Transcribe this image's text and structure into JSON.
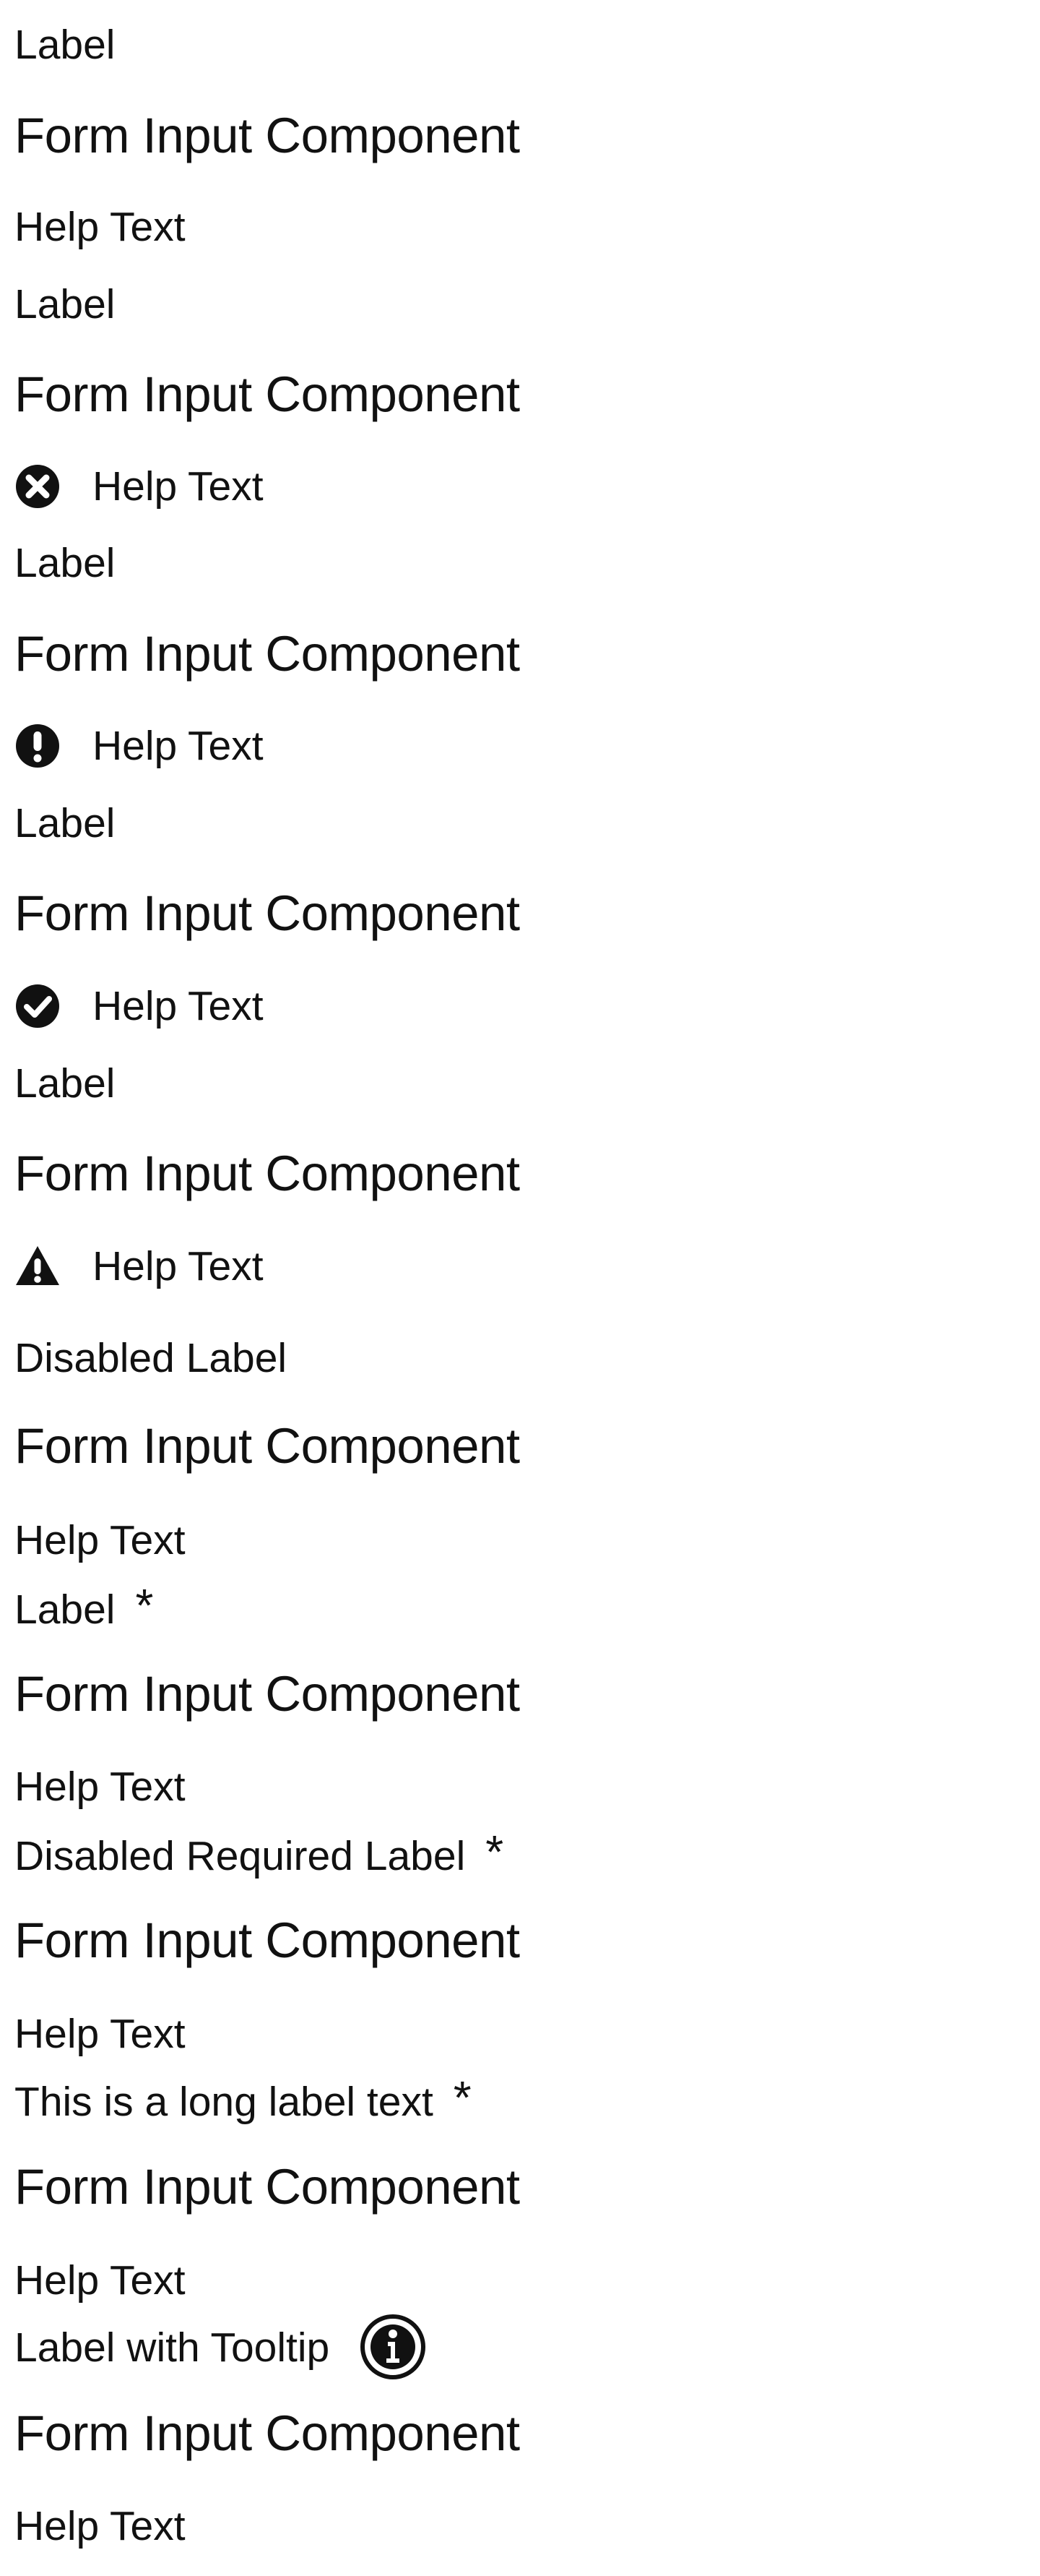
{
  "fields": [
    {
      "label": "Label",
      "input_text": "Form Input Component",
      "help_text": "Help Text"
    },
    {
      "label": "Label",
      "input_text": "Form Input Component",
      "help_text": "Help Text",
      "status_icon": "error-circle-icon"
    },
    {
      "label": "Label",
      "input_text": "Form Input Component",
      "help_text": "Help Text",
      "status_icon": "warning-circle-icon"
    },
    {
      "label": "Label",
      "input_text": "Form Input Component",
      "help_text": "Help Text",
      "status_icon": "success-check-icon"
    },
    {
      "label": "Label",
      "input_text": "Form Input Component",
      "help_text": "Help Text",
      "status_icon": "warning-triangle-icon"
    },
    {
      "label": "Disabled Label",
      "input_text": "Form Input Component",
      "help_text": "Help Text"
    },
    {
      "label": "Label",
      "required_marker": "*",
      "input_text": "Form Input Component",
      "help_text": "Help Text"
    },
    {
      "label": "Disabled Required Label",
      "required_marker": "*",
      "input_text": "Form Input Component",
      "help_text": "Help Text"
    },
    {
      "label": "This is a long label text",
      "required_marker": "*",
      "input_text": "Form Input Component",
      "help_text": "Help Text"
    },
    {
      "label": "Label with Tooltip",
      "tooltip_icon": "info-icon",
      "input_text": "Form Input Component",
      "help_text": "Help Text"
    }
  ]
}
